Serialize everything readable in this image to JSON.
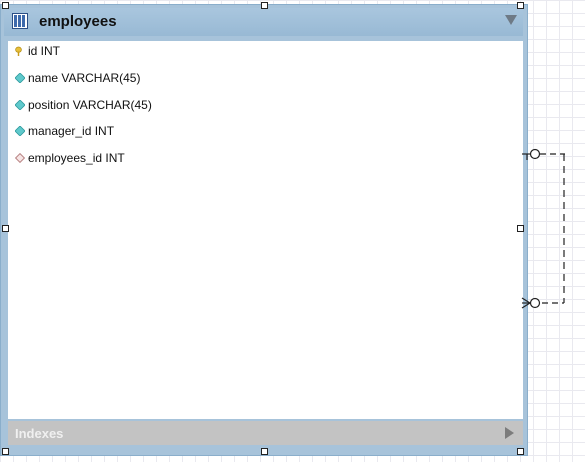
{
  "entity": {
    "title": "employees",
    "icon": "table-icon",
    "columns": [
      {
        "label": "id INT",
        "icon": "primary-key-icon"
      },
      {
        "label": "name VARCHAR(45)",
        "icon": "column-icon"
      },
      {
        "label": "position VARCHAR(45)",
        "icon": "column-icon"
      },
      {
        "label": "manager_id INT",
        "icon": "column-icon"
      },
      {
        "label": "employees_id INT",
        "icon": "foreign-key-icon"
      }
    ],
    "indexes_label": "Indexes"
  },
  "colors": {
    "header": "#a9c6de",
    "key": "#e8c03a",
    "column": "#54c6c9",
    "foreign_key": "#e8b8b8",
    "indexes_bar": "#c3c3c3"
  }
}
